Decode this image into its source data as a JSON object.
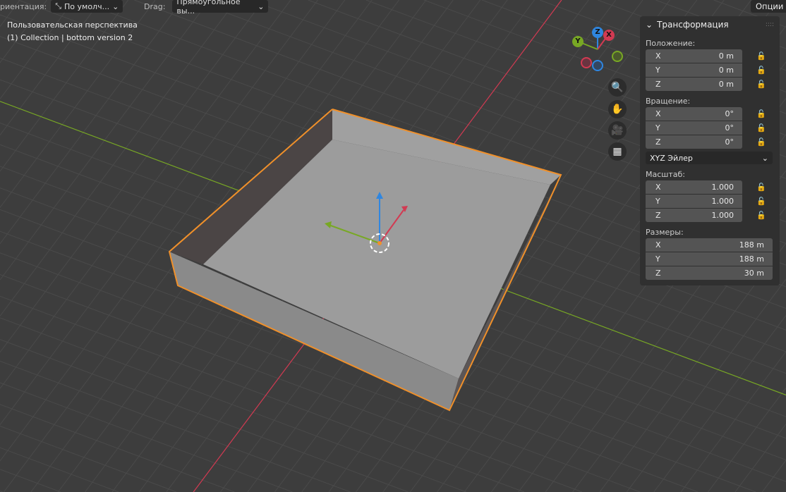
{
  "header": {
    "orientation_label": "риентация:",
    "orientation_value": "По умолч...",
    "drag_label": "Drag:",
    "drag_value": "Прямоугольное вы...",
    "options_label": "Опции"
  },
  "overlay": {
    "view_name": "Пользовательская перспектива",
    "collection": "(1) Collection | bottom version 2"
  },
  "gizmo": {
    "x": "X",
    "y": "Y",
    "z": "Z",
    "colors": {
      "x": "#d23a52",
      "y": "#78a824",
      "z": "#2f86e0"
    }
  },
  "panel": {
    "title": "Трансформация",
    "location": {
      "label": "Положение:",
      "x": "0 m",
      "y": "0 m",
      "z": "0 m"
    },
    "rotation": {
      "label": "Вращение:",
      "x": "0°",
      "y": "0°",
      "z": "0°",
      "mode": "XYZ Эйлер"
    },
    "scale": {
      "label": "Масштаб:",
      "x": "1.000",
      "y": "1.000",
      "z": "1.000"
    },
    "dimensions": {
      "label": "Размеры:",
      "x": "188 m",
      "y": "188 m",
      "z": "30 m"
    },
    "axis_labels": {
      "x": "X",
      "y": "Y",
      "z": "Z"
    }
  },
  "colors": {
    "selection": "#f0902a",
    "background": "#3d3d3d"
  }
}
